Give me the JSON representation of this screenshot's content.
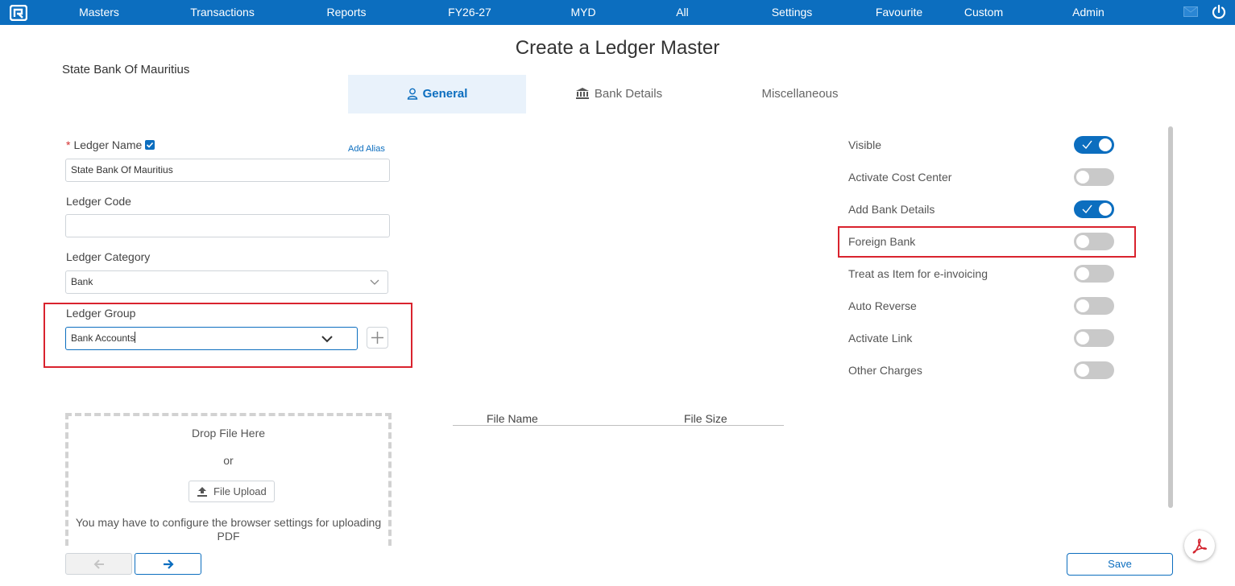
{
  "colors": {
    "primary": "#0c6ebf",
    "highlight": "#d9232e",
    "toggle_off": "#c9c9c9",
    "tab_active_bg": "#e9f2fb"
  },
  "nav": {
    "items": [
      "Masters",
      "Transactions",
      "Reports",
      "FY26-27",
      "MYD",
      "All",
      "Settings",
      "Favourite",
      "Custom",
      "Admin"
    ],
    "icons": {
      "logo": "app-logo-icon",
      "mail": "mail-icon",
      "power": "power-icon"
    }
  },
  "page": {
    "title": "Create a Ledger Master",
    "company": "State Bank Of Mauritius"
  },
  "tabs": [
    {
      "label": "General",
      "icon": "user-icon",
      "active": true
    },
    {
      "label": "Bank Details",
      "icon": "bank-icon",
      "active": false
    },
    {
      "label": "Miscellaneous",
      "active": false
    }
  ],
  "form": {
    "ledger_name": {
      "label": "Ledger Name",
      "required_mark": "*",
      "value": "State Bank Of Mauritius",
      "add_alias": "Add Alias",
      "checked": true
    },
    "ledger_code": {
      "label": "Ledger Code",
      "value": ""
    },
    "ledger_category": {
      "label": "Ledger Category",
      "value": "Bank"
    },
    "ledger_group": {
      "label": "Ledger Group",
      "value": "Bank Accounts"
    }
  },
  "toggles": [
    {
      "label": "Visible",
      "on": true
    },
    {
      "label": "Activate Cost Center",
      "on": false
    },
    {
      "label": "Add Bank Details",
      "on": true
    },
    {
      "label": "Foreign Bank",
      "on": false
    },
    {
      "label": "Treat as Item for e-invoicing",
      "on": false
    },
    {
      "label": "Auto Reverse",
      "on": false
    },
    {
      "label": "Activate Link",
      "on": false
    },
    {
      "label": "Other Charges",
      "on": false
    }
  ],
  "upload": {
    "drop_text": "Drop File Here",
    "or_text": "or",
    "button": "File Upload",
    "note": "You may have to configure the browser settings for uploading PDF"
  },
  "files": {
    "col_name": "File Name",
    "col_size": "File Size"
  },
  "buttons": {
    "save": "Save",
    "prev": "arrow-left-icon",
    "next": "arrow-right-icon",
    "pdf": "pdf-icon"
  }
}
